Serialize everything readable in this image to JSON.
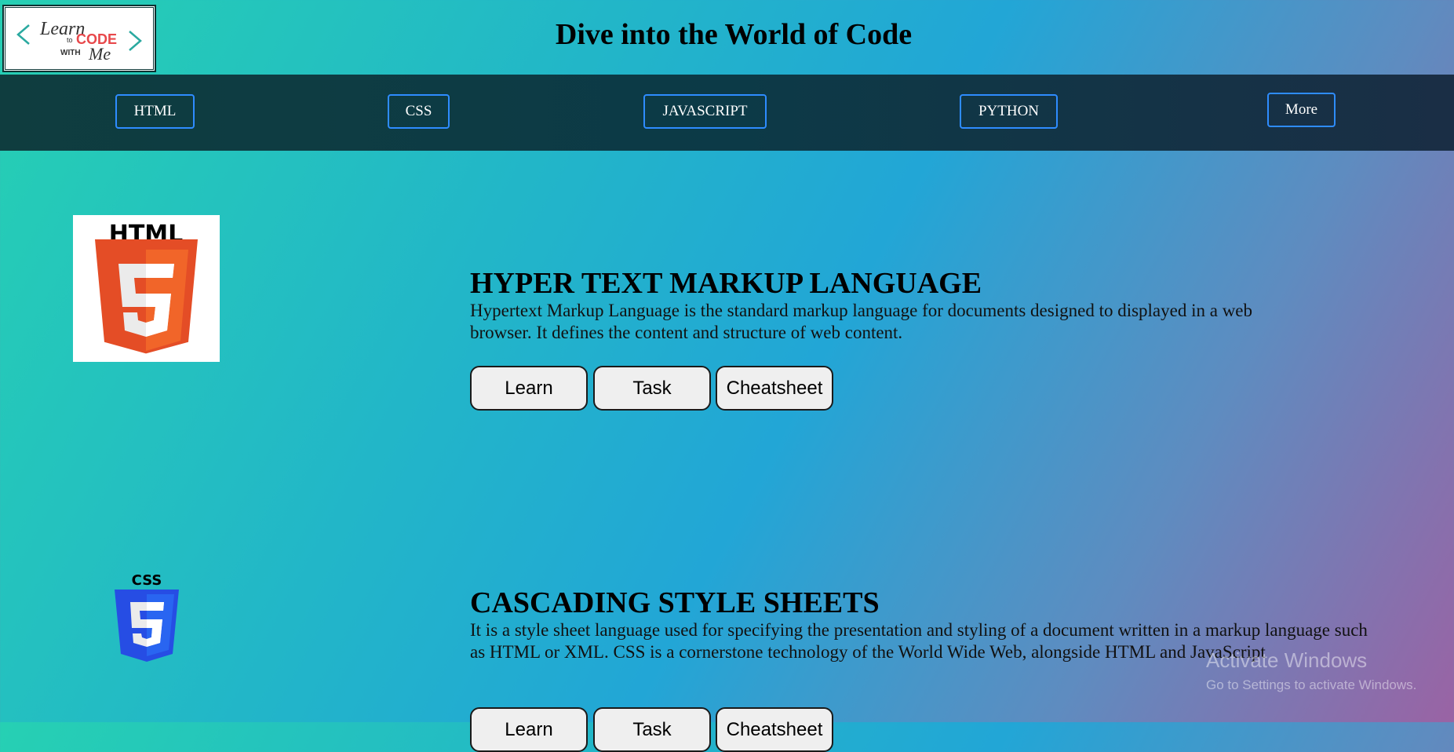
{
  "header": {
    "logo": {
      "line1": "Learn",
      "line2": "to",
      "line3": "CODE",
      "line4": "WITH",
      "line5": "Me"
    },
    "title": "Dive into the World of Code"
  },
  "nav": {
    "items": [
      "HTML",
      "CSS",
      "JAVASCRIPT",
      "PYTHON",
      "More"
    ]
  },
  "sections": [
    {
      "icon": "html5-logo",
      "icon_label": "HTML",
      "title": "HYPER TEXT MARKUP LANGUAGE",
      "description": "Hypertext Markup Language is the standard markup language for documents designed to displayed in a web browser. It defines the content and structure of web content.",
      "buttons": [
        "Learn",
        "Task",
        "Cheatsheet"
      ]
    },
    {
      "icon": "css3-logo",
      "icon_label": "CSS",
      "title": "CASCADING STYLE SHEETS",
      "description": "It is a style sheet language used for specifying the presentation and styling of a document written in a markup language such as HTML or XML. CSS is a cornerstone technology of the World Wide Web, alongside HTML and JavaScript",
      "buttons": [
        "Learn",
        "Task",
        "Cheatsheet"
      ]
    }
  ],
  "watermark": {
    "title": "Activate Windows",
    "subtitle": "Go to Settings to activate Windows."
  },
  "colors": {
    "nav_border": "#2e8cff",
    "html_orange": "#e44d26",
    "css_blue": "#264de4"
  }
}
